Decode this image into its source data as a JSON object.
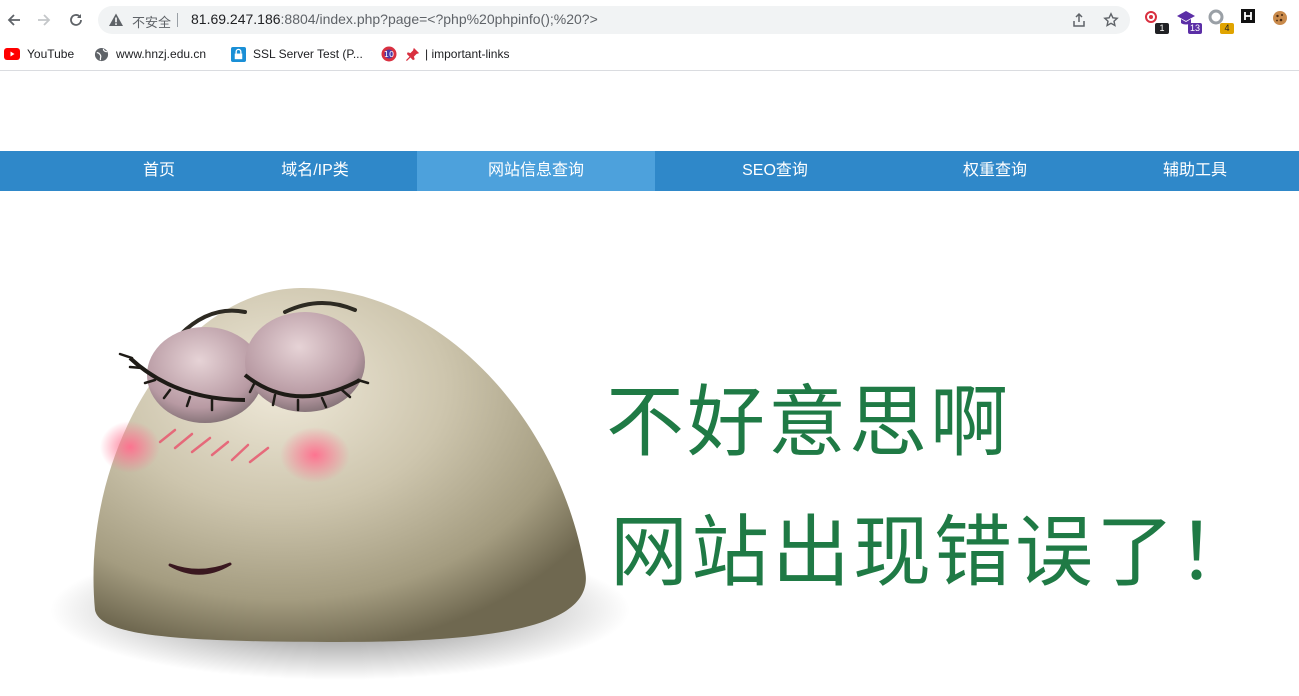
{
  "browser": {
    "security_label": "不安全",
    "url_host": "81.69.247.186",
    "url_rest": ":8804/index.php?page=<?php%20phpinfo();%20?>",
    "extensions": [
      {
        "icon": "cloud-icon",
        "badge": "1",
        "badge_color": "#202124"
      },
      {
        "icon": "graduation-cap-icon",
        "badge": "13",
        "badge_color": "#5b2ea6"
      },
      {
        "icon": "ring-icon",
        "badge": "4",
        "badge_color": "#e0a400"
      },
      {
        "icon": "h-icon",
        "badge": ""
      },
      {
        "icon": "cookie-icon",
        "badge": ""
      }
    ]
  },
  "bookmarks": [
    {
      "label": "YouTube",
      "icon": "youtube-icon"
    },
    {
      "label": "www.hnzj.edu.cn",
      "icon": "globe-icon"
    },
    {
      "label": "SSL Server Test (P...",
      "icon": "lock-icon"
    },
    {
      "label": "",
      "icon": "badge-10-icon",
      "badge": "10"
    },
    {
      "label": "| important-links",
      "icon": "pin-icon"
    }
  ],
  "nav": {
    "items": [
      "首页",
      "域名/IP类",
      "网站信息查询",
      "SEO查询",
      "权重查询",
      "辅助工具"
    ],
    "active_index": 2
  },
  "error": {
    "line1": "不好意思啊",
    "line2": "网站出现错误了！"
  },
  "colors": {
    "nav_bg": "#2f88c9",
    "nav_active": "#4da1dc",
    "error_text": "#1f7a45"
  }
}
